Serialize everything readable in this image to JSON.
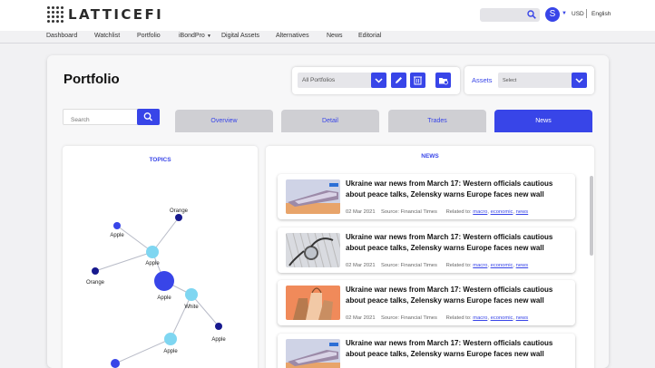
{
  "brand": {
    "name": "LATTICEFI"
  },
  "header": {
    "avatar_letter": "S",
    "currency": "USD",
    "language": "English"
  },
  "nav": [
    "Dashboard",
    "Watchlist",
    "Portfolio",
    "iBondPro",
    "Digital Assets",
    "Alternatives",
    "News",
    "Editorial"
  ],
  "page": {
    "title": "Portfolio"
  },
  "controls": {
    "portfolio_select": "All Portfolios",
    "assets_label": "Assets",
    "assets_select": "Select"
  },
  "search": {
    "placeholder": "Search"
  },
  "tabs": [
    {
      "label": "Overview"
    },
    {
      "label": "Detail"
    },
    {
      "label": "Trades"
    },
    {
      "label": "News",
      "active": true
    }
  ],
  "topics": {
    "title": "TOPICS",
    "nodes": [
      {
        "label": "Apple",
        "color": "#3845e8",
        "size": "small"
      },
      {
        "label": "Orange",
        "color": "#17198e",
        "size": "small"
      },
      {
        "label": "Apple",
        "color": "#7fd6f1",
        "size": "medium"
      },
      {
        "label": "Orange",
        "color": "#17198e",
        "size": "small"
      },
      {
        "label": "Apple",
        "color": "#3845e8",
        "size": "large"
      },
      {
        "label": "White",
        "color": "#7fd6f1",
        "size": "medium"
      },
      {
        "label": "Apple",
        "color": "#17198e",
        "size": "small"
      },
      {
        "label": "Apple",
        "color": "#7fd6f1",
        "size": "medium"
      }
    ]
  },
  "news": {
    "title": "NEWS",
    "source_label": "Source:",
    "related_label": "Related to:",
    "items": [
      {
        "headline": "Ukraine war news from March 17: Western officials cautious about peace talks, Zelensky warns Europe faces new wall",
        "date": "02 Mar 2021",
        "source": "Financial Times",
        "tags": [
          "macro",
          "economic",
          "news"
        ],
        "thumb": "train"
      },
      {
        "headline": "Ukraine war news from March 17: Western officials cautious about peace talks, Zelensky warns Europe faces new wall",
        "date": "02 Mar 2021",
        "source": "Financial Times",
        "tags": [
          "macro",
          "economic",
          "news"
        ],
        "thumb": "stethoscope"
      },
      {
        "headline": "Ukraine war news from March 17: Western officials cautious about peace talks, Zelensky warns Europe faces new wall",
        "date": "02 Mar 2021",
        "source": "Financial Times",
        "tags": [
          "macro",
          "economic",
          "news"
        ],
        "thumb": "bags"
      },
      {
        "headline": "Ukraine war news from March 17: Western officials cautious about peace talks, Zelensky warns Europe faces new wall",
        "date": "",
        "source": "",
        "tags": [],
        "thumb": "train"
      }
    ]
  },
  "colors": {
    "accent": "#3845e8",
    "dark_node": "#17198e",
    "light_node": "#7fd6f1"
  }
}
